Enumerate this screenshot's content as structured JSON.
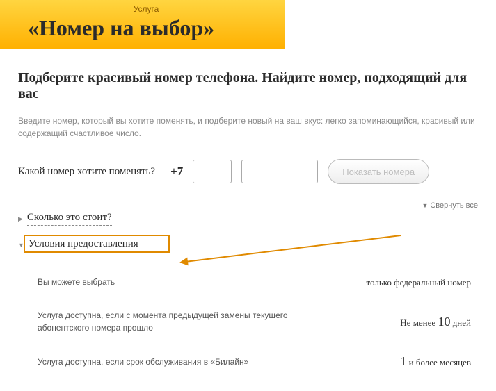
{
  "header": {
    "category": "Услуга",
    "title": "«Номер на выбор»"
  },
  "heading": "Подберите красивый номер телефона. Найдите номер, подходящий для вас",
  "intro": "Введите номер, который вы хотите поменять, и подберите новый на ваш вкус: легко запоминающийся, красивый или содержащий счастливое число.",
  "form": {
    "label": "Какой номер хотите поменять?",
    "prefix": "+7",
    "button": "Показать номера"
  },
  "collapse_all": "Свернуть все",
  "accordion": {
    "cost_title": "Сколько это стоит?",
    "terms_title": "Условия предоставления"
  },
  "terms": [
    {
      "left": "Вы можете выбрать",
      "right_prefix": "",
      "right_big": "",
      "right_suffix": "только федеральный номер"
    },
    {
      "left": "Услуга доступна, если с момента предыдущей замены текущего абонентского номера прошло",
      "right_prefix": "Не менее ",
      "right_big": "10",
      "right_suffix": " дней"
    },
    {
      "left": "Услуга доступна, если срок обслуживания в «Билайн»",
      "right_prefix": "",
      "right_big": "1",
      "right_suffix": " и более месяцев"
    }
  ]
}
